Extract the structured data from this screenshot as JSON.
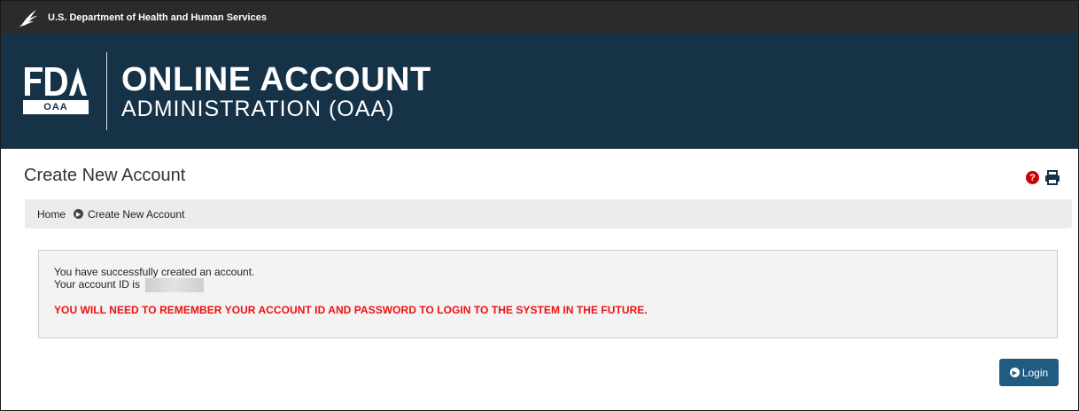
{
  "top_bar": {
    "agency": "U.S. Department of Health and Human Services",
    "logo_icon": "hhs-eagle-icon"
  },
  "banner": {
    "logo_letters": "FDA",
    "logo_tag": "OAA",
    "title_line1": "ONLINE ACCOUNT",
    "title_line2": "ADMINISTRATION (OAA)",
    "background": "#163247"
  },
  "page": {
    "title": "Create New Account",
    "help_icon": "question-circle-icon",
    "print_icon": "print-icon"
  },
  "breadcrumb": {
    "home": "Home",
    "current": "Create New Account"
  },
  "message": {
    "line1": "You have successfully created an account.",
    "line2": "Your account ID is",
    "warning": "YOU WILL NEED TO REMEMBER YOUR ACCOUNT ID AND PASSWORD TO LOGIN TO THE SYSTEM IN THE FUTURE.",
    "warning_color": "#ee1111"
  },
  "actions": {
    "login_label": "Login",
    "button_color": "#215b82"
  }
}
